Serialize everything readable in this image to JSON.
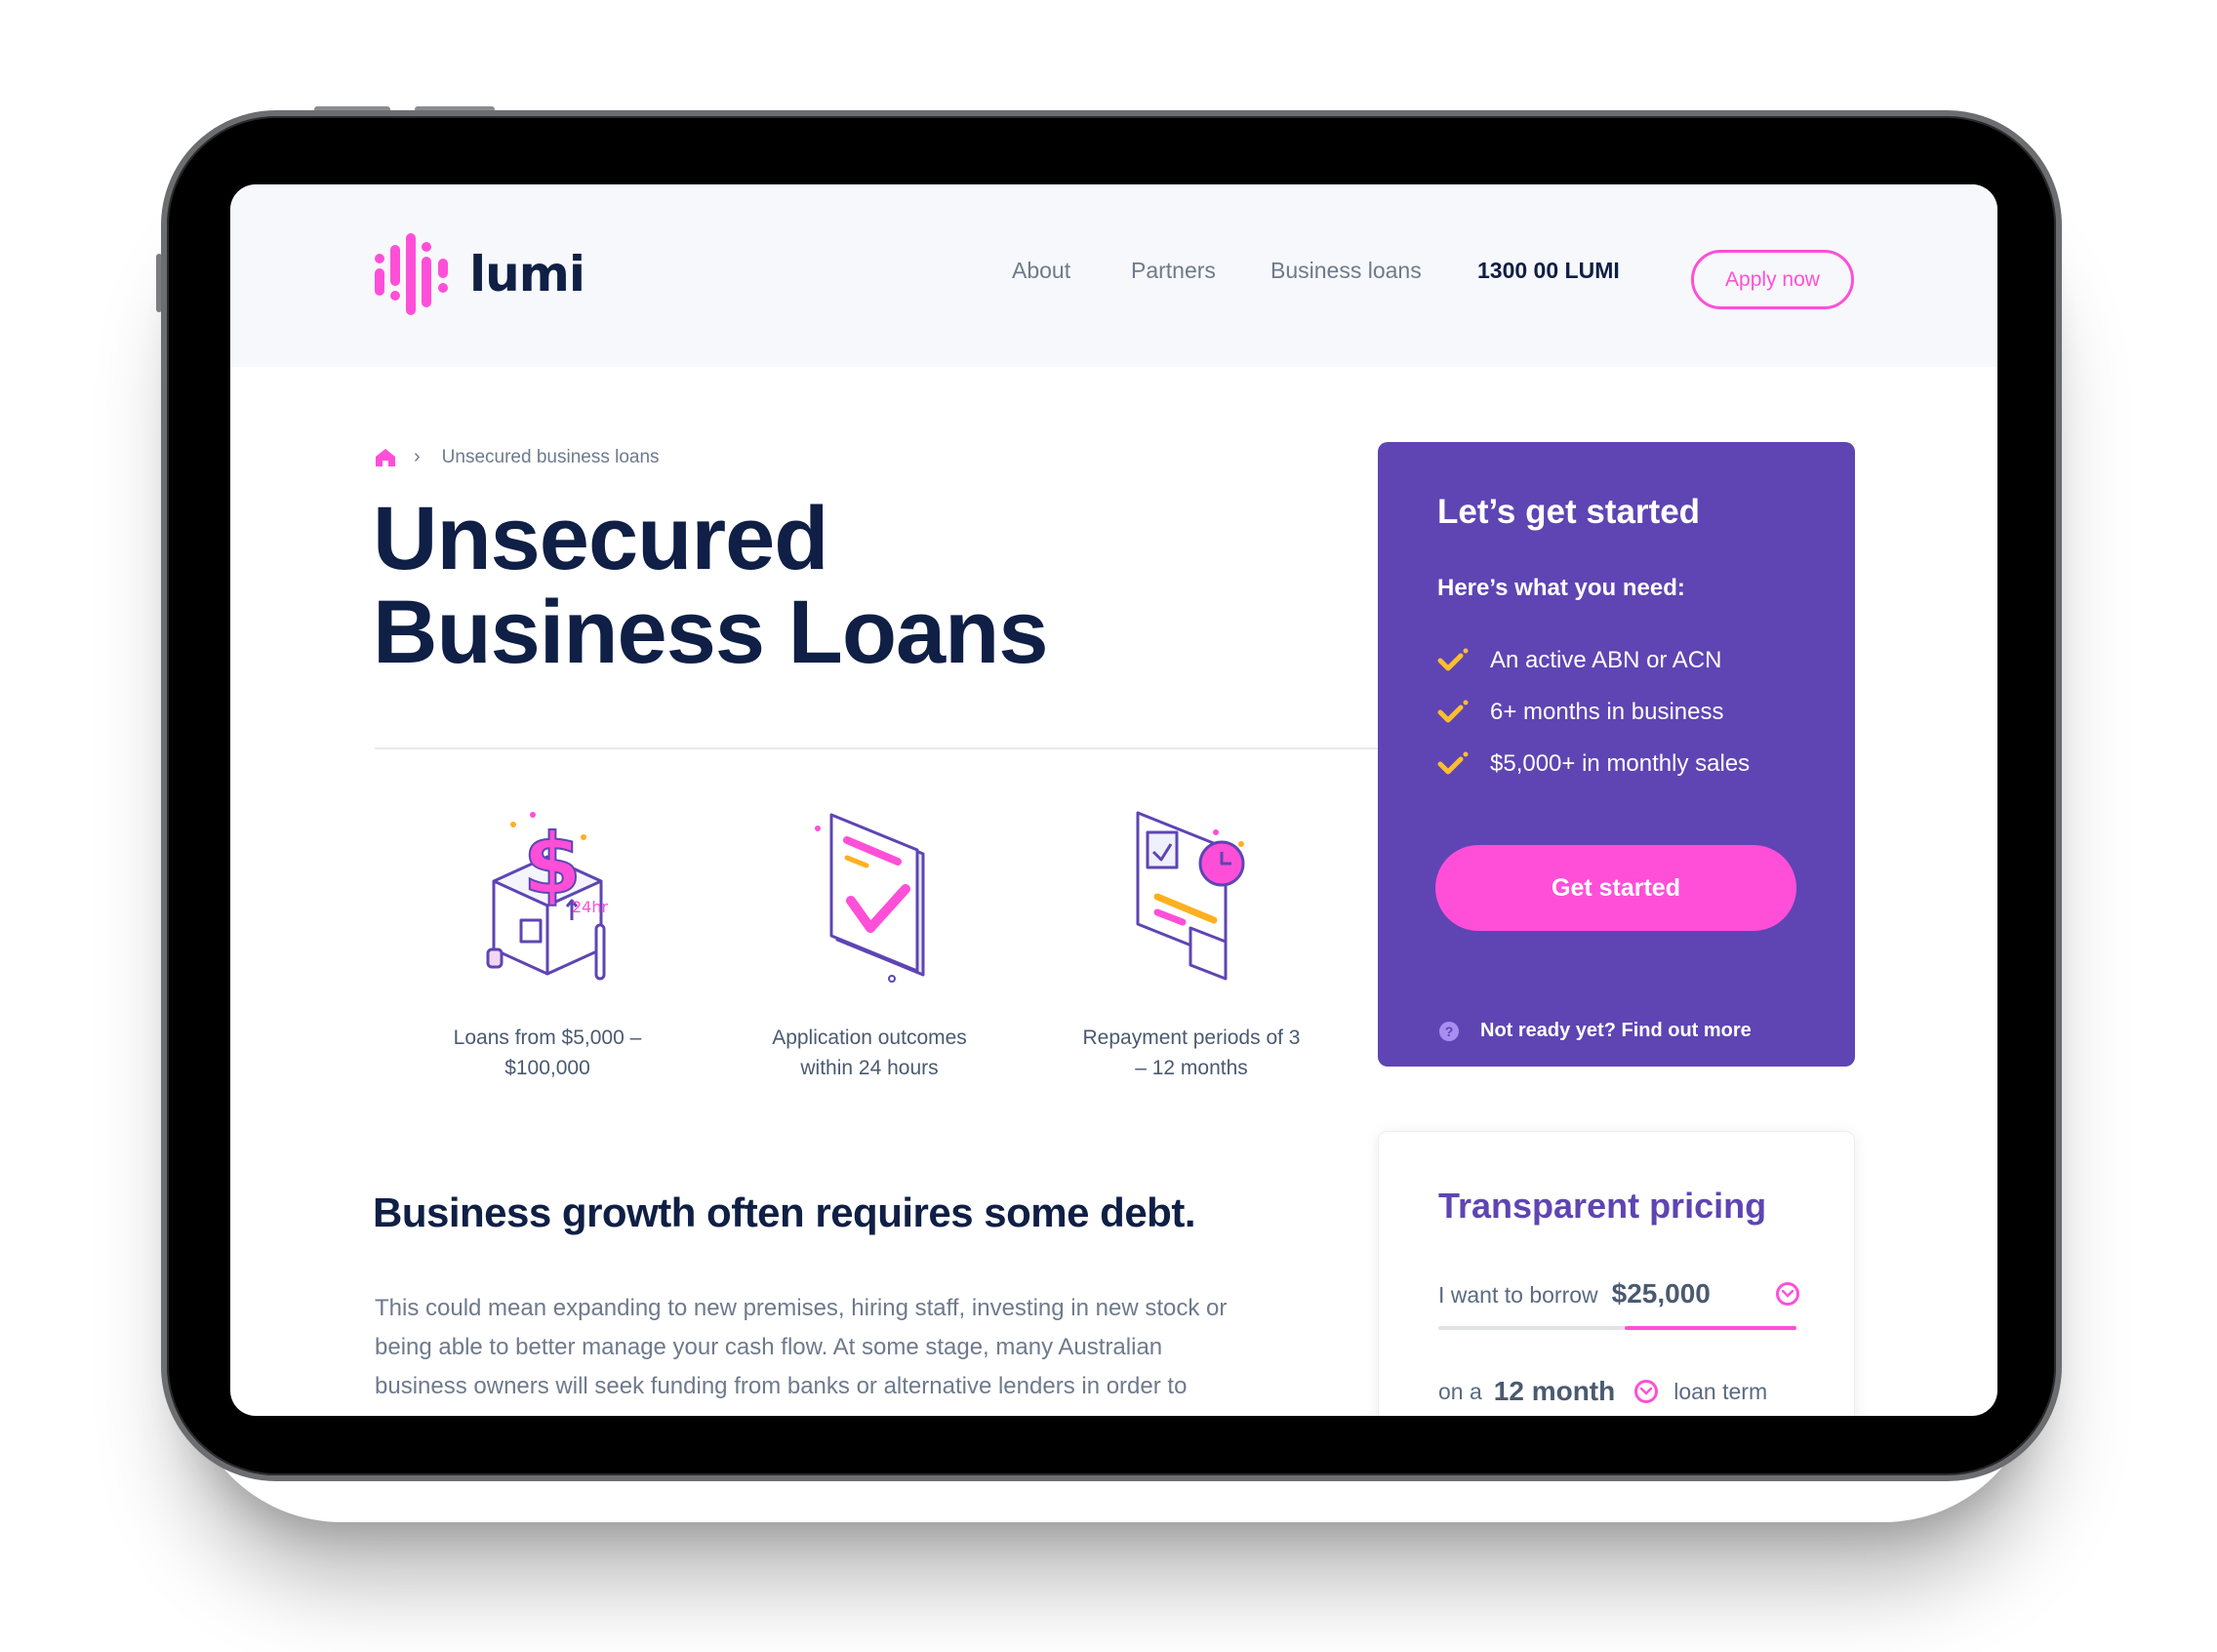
{
  "brand": {
    "name": "lumi",
    "accent_color": "#ff4fd8",
    "primary_color": "#5e45b3",
    "dark_color": "#0f1f45"
  },
  "header": {
    "nav": [
      {
        "label": "About"
      },
      {
        "label": "Partners"
      },
      {
        "label": "Business loans"
      }
    ],
    "phone": "1300 00 LUMI",
    "apply_label": "Apply now"
  },
  "breadcrumb": {
    "home_icon": "home-icon",
    "separator_icon": "chevron-right-icon",
    "current": "Unsecured business loans"
  },
  "hero": {
    "title_line1": "Unsecured",
    "title_line2": "Business Loans"
  },
  "features": [
    {
      "icon": "dollar-box-illustration",
      "label_line1": "Loans from $5,000 –",
      "label_line2": "$100,000"
    },
    {
      "icon": "approved-document-illustration",
      "label_line1": "Application outcomes",
      "label_line2": "within 24 hours"
    },
    {
      "icon": "repayment-schedule-illustration",
      "label_line1": "Repayment periods of 3",
      "label_line2": "– 12 months"
    }
  ],
  "get_started_card": {
    "title": "Let’s get started",
    "subtitle": "Here’s what you need:",
    "requirements": [
      "An active ABN or ACN",
      "6+ months in business",
      "$5,000+ in monthly sales"
    ],
    "button_label": "Get started",
    "help_link": "Not ready yet? Find out more"
  },
  "pricing_card": {
    "title": "Transparent pricing",
    "borrow_prefix": "I want to borrow",
    "borrow_amount": "$25,000",
    "borrow_slider_fraction": 0.48,
    "term_prefix": "on a",
    "term_value": "12 month",
    "term_suffix": "loan term"
  },
  "content": {
    "heading": "Business growth often requires some debt.",
    "paragraph_lines": [
      "This could mean expanding to new premises, hiring staff, investing in new stock or",
      "being able to better manage your cash flow. At some stage, many Australian",
      "business owners will seek funding from banks or alternative lenders in order to"
    ]
  }
}
